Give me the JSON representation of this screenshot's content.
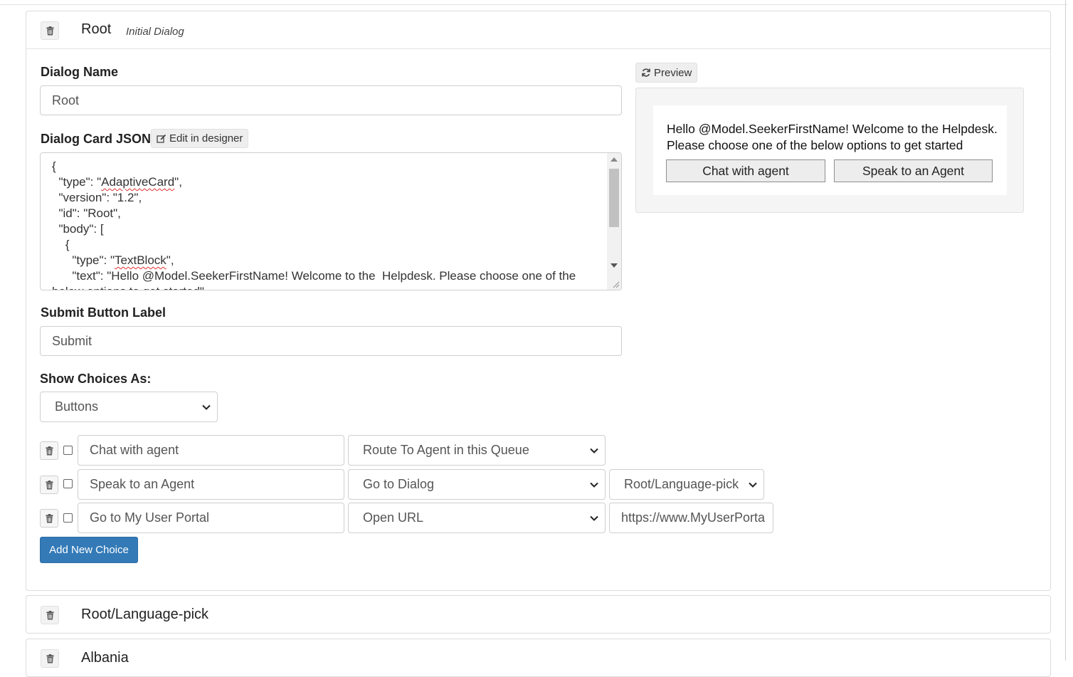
{
  "root_panel": {
    "title": "Root",
    "subtitle": "Initial Dialog",
    "dialog_name_label": "Dialog Name",
    "dialog_name_value": "Root",
    "card_json_label": "Dialog Card JSON",
    "edit_designer_label": "Edit in designer",
    "card_json_lines": [
      "{",
      "  \"type\": \"",
      "AdaptiveCard",
      "\",",
      "  \"version\": \"1.2\",",
      "  \"id\": \"Root\",",
      "  \"body\": [",
      "    {",
      "      \"type\": \"",
      "TextBlock",
      "\",",
      "      \"text\": \"Hello @Model.SeekerFirstName! Welcome to the  Helpdesk. Please choose one of the",
      "below options to get started\","
    ],
    "submit_label": "Submit Button Label",
    "submit_value": "Submit",
    "show_choices_label": "Show Choices As:",
    "show_choices_value": "Buttons",
    "choices": [
      {
        "text": "Chat with agent",
        "action": "Route To Agent in this Queue"
      },
      {
        "text": "Speak to an Agent",
        "action": "Go to Dialog",
        "target": "Root/Language-pick"
      },
      {
        "text": "Go to My User Portal",
        "action": "Open URL",
        "target": "https://www.MyUserPorta"
      }
    ],
    "add_choice_label": "Add New Choice"
  },
  "preview": {
    "button_label": "Preview",
    "card_text": "Hello @Model.SeekerFirstName! Welcome to the Helpdesk. Please choose one of the below options to get started",
    "card_buttons": [
      "Chat with agent",
      "Speak to an Agent"
    ]
  },
  "other_panels": [
    {
      "title": "Root/Language-pick"
    },
    {
      "title": "Albania"
    }
  ],
  "icons": {
    "trash": "trash-icon",
    "refresh": "refresh-icon",
    "edit": "edit-icon",
    "chevron": "chevron-down-icon"
  },
  "colors": {
    "primary": "#337ab7",
    "border": "#cfcfcf",
    "spellcheck": "#e03030"
  }
}
